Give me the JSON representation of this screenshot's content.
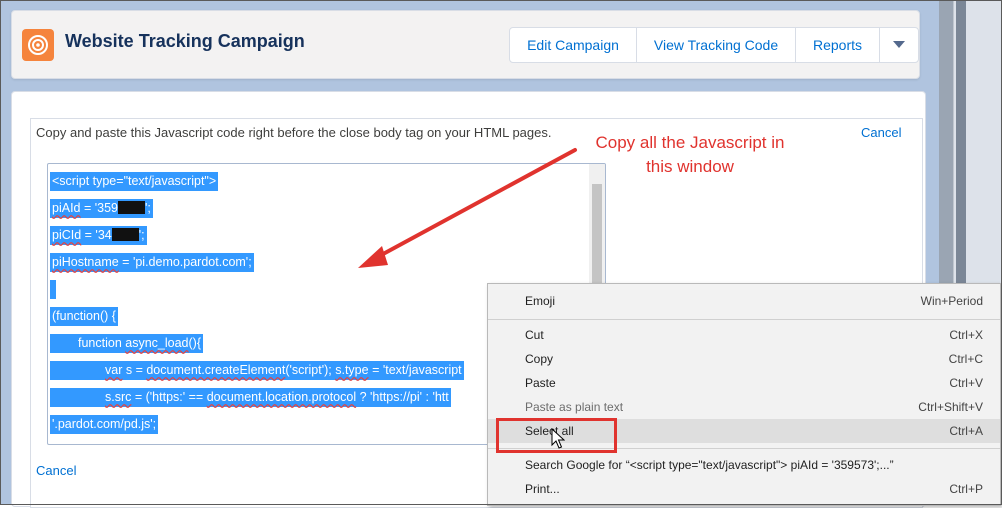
{
  "header": {
    "title": "Website Tracking Campaign",
    "buttons": {
      "edit": "Edit Campaign",
      "view_code": "View Tracking Code",
      "reports": "Reports"
    }
  },
  "main": {
    "instructions": "Copy and paste this Javascript code right before the close body tag on your HTML pages.",
    "cancel_top": "Cancel",
    "cancel_bottom": "Cancel",
    "code": {
      "line1": "<script type=\"text/javascript\">",
      "line2_a": "piAId",
      "line2_b": " = '359",
      "line2_c": "';",
      "line3_a": "piCId",
      "line3_b": " = '34",
      "line3_c": "';",
      "line4_a": "piHostname",
      "line4_b": " = 'pi.demo.pardot.com';",
      "line6": "(function() {",
      "line7_a": "function ",
      "line7_b": "async_load",
      "line7_c": "(){",
      "line8_a": "var",
      "line8_b": " s = ",
      "line8_c": "document.createElement",
      "line8_d": "('script'); ",
      "line8_e": "s.type",
      "line8_f": " = 'text/javascript",
      "line9_a": "s.src",
      "line9_b": " = ('https:' == ",
      "line9_c": "document.location.protocol",
      "line9_d": " ? 'https://pi' : 'htt",
      "line10": "'.pardot.com/pd.js';"
    }
  },
  "annotation": {
    "line1": "Copy all the Javascript in",
    "line2": "this window",
    "color": "#e0332e"
  },
  "context_menu": {
    "items": [
      {
        "label": "Emoji",
        "shortcut": "Win+Period"
      },
      {
        "label": "Cut",
        "shortcut": "Ctrl+X"
      },
      {
        "label": "Copy",
        "shortcut": "Ctrl+C"
      },
      {
        "label": "Paste",
        "shortcut": "Ctrl+V"
      },
      {
        "label": "Paste as plain text",
        "shortcut": "Ctrl+Shift+V"
      },
      {
        "label": "Select all",
        "shortcut": "Ctrl+A"
      },
      {
        "label": "Search Google for “<script type=\"text/javascript\"> piAId = '359573';...”",
        "shortcut": ""
      },
      {
        "label": "Print...",
        "shortcut": "Ctrl+P"
      }
    ]
  },
  "colors": {
    "accent_link": "#0070d2",
    "selection": "#3399ff",
    "campaign_icon": "#f5843d",
    "annotation_red": "#e0332e"
  }
}
